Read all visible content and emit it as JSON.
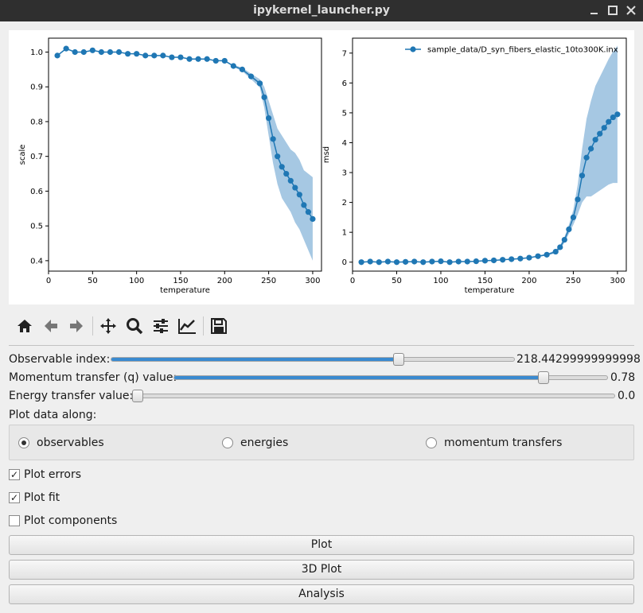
{
  "window": {
    "title": "ipykernel_launcher.py"
  },
  "toolbar": {
    "items": [
      "home-icon",
      "back-arrow-icon",
      "forward-arrow-icon",
      "pan-icon",
      "zoom-icon",
      "subplots-config-icon",
      "edit-axes-icon",
      "save-icon"
    ]
  },
  "controls": {
    "observable_label": "Observable index:",
    "observable_value": "218.44299999999998",
    "observable_fraction": 0.71,
    "q_label": "Momentum transfer (q) value:",
    "q_value": "0.78",
    "q_fraction": 0.85,
    "energy_label": "Energy transfer value:",
    "energy_value": "0.0",
    "energy_fraction": 0.0,
    "plot_along_label": "Plot data along:",
    "radio_options": [
      {
        "label": "observables",
        "selected": true
      },
      {
        "label": "energies",
        "selected": false
      },
      {
        "label": "momentum transfers",
        "selected": false
      }
    ],
    "checkboxes": [
      {
        "label": "Plot errors",
        "checked": true
      },
      {
        "label": "Plot fit",
        "checked": true
      },
      {
        "label": "Plot components",
        "checked": false
      }
    ],
    "buttons": {
      "plot": "Plot",
      "plot3d": "3D Plot",
      "analysis": "Analysis"
    }
  },
  "colors": {
    "series": "#1f77b4",
    "band": "#a6c8e3",
    "slider_fill": "#3a8ad0"
  },
  "chart_data": [
    {
      "type": "line",
      "xlabel": "temperature",
      "ylabel": "scale",
      "xlim": [
        0,
        310
      ],
      "ylim": [
        0.37,
        1.04
      ],
      "xticks": [
        0,
        50,
        100,
        150,
        200,
        250,
        300
      ],
      "yticks": [
        0.4,
        0.5,
        0.6,
        0.7,
        0.8,
        0.9,
        1.0
      ],
      "ytick_labels": [
        "0.4",
        "0.5",
        "0.6",
        "0.7",
        "0.8",
        "0.9",
        "1.0"
      ],
      "x": [
        10,
        20,
        30,
        40,
        50,
        60,
        70,
        80,
        90,
        100,
        110,
        120,
        130,
        140,
        150,
        160,
        170,
        180,
        190,
        200,
        210,
        220,
        230,
        240,
        245,
        250,
        255,
        260,
        265,
        270,
        275,
        280,
        285,
        290,
        295,
        300
      ],
      "y": [
        0.99,
        1.01,
        1.0,
        1.0,
        1.005,
        1.0,
        1.0,
        1.0,
        0.995,
        0.995,
        0.99,
        0.99,
        0.99,
        0.985,
        0.985,
        0.98,
        0.98,
        0.98,
        0.975,
        0.975,
        0.96,
        0.95,
        0.93,
        0.91,
        0.87,
        0.81,
        0.75,
        0.7,
        0.67,
        0.65,
        0.63,
        0.61,
        0.59,
        0.56,
        0.54,
        0.52
      ],
      "err": [
        0.0,
        0.0,
        0.0,
        0.0,
        0.0,
        0.0,
        0.0,
        0.0,
        0.0,
        0.0,
        0.0,
        0.0,
        0.0,
        0.0,
        0.0,
        0.0,
        0.0,
        0.0,
        0.0,
        0.0,
        0.003,
        0.005,
        0.008,
        0.012,
        0.03,
        0.05,
        0.07,
        0.08,
        0.09,
        0.09,
        0.09,
        0.1,
        0.1,
        0.1,
        0.11,
        0.12
      ]
    },
    {
      "type": "line",
      "xlabel": "temperature",
      "ylabel": "msd",
      "xlim": [
        0,
        310
      ],
      "ylim": [
        -0.3,
        7.5
      ],
      "xticks": [
        0,
        50,
        100,
        150,
        200,
        250,
        300
      ],
      "yticks": [
        0,
        1,
        2,
        3,
        4,
        5,
        6,
        7
      ],
      "ytick_labels": [
        "0",
        "1",
        "2",
        "3",
        "4",
        "5",
        "6",
        "7"
      ],
      "legend": "sample_data/D_syn_fibers_elastic_10to300K.inx",
      "legend_position": "top-right",
      "x": [
        10,
        20,
        30,
        40,
        50,
        60,
        70,
        80,
        90,
        100,
        110,
        120,
        130,
        140,
        150,
        160,
        170,
        180,
        190,
        200,
        210,
        220,
        230,
        235,
        240,
        245,
        250,
        255,
        260,
        265,
        270,
        275,
        280,
        285,
        290,
        295,
        300
      ],
      "y": [
        0.0,
        0.02,
        0.0,
        0.02,
        0.0,
        0.01,
        0.02,
        0.0,
        0.02,
        0.03,
        0.0,
        0.02,
        0.02,
        0.03,
        0.05,
        0.06,
        0.08,
        0.1,
        0.12,
        0.15,
        0.2,
        0.25,
        0.35,
        0.5,
        0.75,
        1.1,
        1.5,
        2.1,
        2.9,
        3.5,
        3.8,
        4.1,
        4.3,
        4.5,
        4.7,
        4.85,
        4.95
      ],
      "err": [
        0.0,
        0.0,
        0.0,
        0.0,
        0.0,
        0.0,
        0.0,
        0.0,
        0.0,
        0.0,
        0.0,
        0.0,
        0.0,
        0.0,
        0.0,
        0.0,
        0.0,
        0.0,
        0.0,
        0.0,
        0.02,
        0.03,
        0.05,
        0.07,
        0.1,
        0.15,
        0.25,
        0.5,
        0.9,
        1.3,
        1.6,
        1.8,
        1.9,
        2.0,
        2.1,
        2.2,
        2.3
      ]
    }
  ]
}
